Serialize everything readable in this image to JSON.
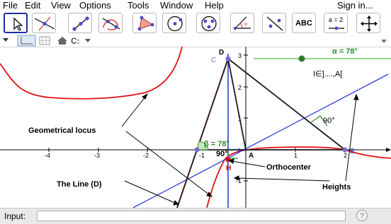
{
  "menu": {
    "items": [
      "File",
      "Edit",
      "View",
      "Options",
      "Tools",
      "Window",
      "Help"
    ],
    "signin": "Sign in..."
  },
  "toolbar": {
    "tools": [
      {
        "icon": "move-arrow-icon"
      },
      {
        "icon": "line-through-point-icon"
      },
      {
        "icon": "segment-icon"
      },
      {
        "icon": "intersect-icon"
      },
      {
        "icon": "polygon-icon"
      },
      {
        "icon": "circle-center-icon"
      },
      {
        "icon": "circle-three-points-icon"
      },
      {
        "icon": "angle-icon"
      },
      {
        "icon": "reflect-line-icon"
      },
      {
        "icon": "text-tool-icon",
        "label": "ABC"
      },
      {
        "icon": "slider-tool-icon",
        "label": "a = 2"
      },
      {
        "icon": "move-graphics-icon"
      }
    ]
  },
  "graphics": {
    "axis_x_ticks": [
      "-4",
      "-3",
      "-2",
      "-1",
      "1",
      "2"
    ],
    "axis_y_ticks": [
      "3",
      "2",
      "1",
      "-1"
    ],
    "slider_label": "α = 78°",
    "interval_text": "I∈]....,A[",
    "angle_90_right": "90°",
    "angle_beta": "β = 78°",
    "angle_90_bottom": "90°",
    "point_labels": {
      "D": "D",
      "C": "C",
      "A": "A",
      "B": "B",
      "H": "H"
    },
    "annotations": {
      "locus": "Geometrical locus",
      "line_d": "The Line (D)",
      "orthocenter": "Orthocenter",
      "heights": "Heights"
    },
    "colors": {
      "locus": "#e01010",
      "triangle": "#1a1a1a",
      "line_d": "#2a3fe0",
      "slider": "#2e8b2e",
      "point": "#6e6ed8"
    }
  },
  "input": {
    "label": "Input:",
    "value": "",
    "help": "?"
  }
}
